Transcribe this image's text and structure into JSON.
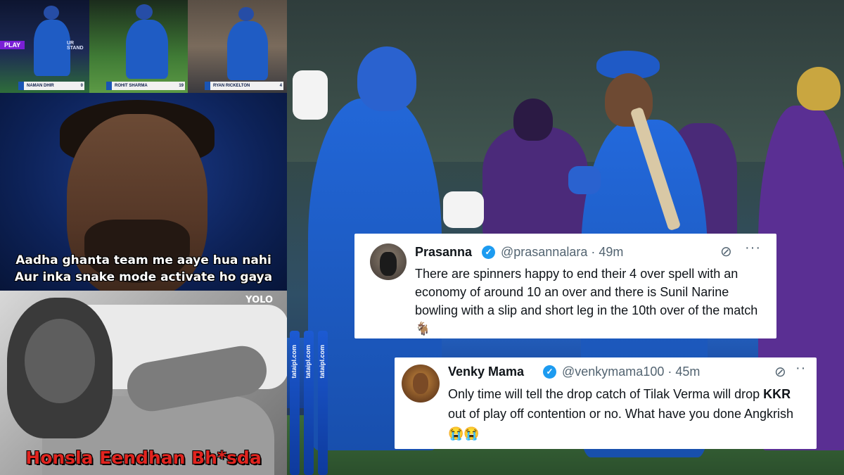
{
  "top_strip": {
    "frame1": {
      "play_tag": "PLAY",
      "stand_tag": "UR STAND",
      "player_name": "NAMAN DHIR",
      "number": "0"
    },
    "frame2": {
      "player_name": "ROHIT SHARMA",
      "number": "19"
    },
    "frame3": {
      "player_name": "RYAN RICKELTON",
      "number": "4"
    }
  },
  "meme_top": {
    "line1": "Aadha ghanta team me aaye hua nahi",
    "line2": "Aur inka snake mode activate ho gaya"
  },
  "meme_bottom": {
    "watermark": "YOLO",
    "caption": "Honsla Eendhan Bh*sda"
  },
  "main_photo": {
    "stump_text": "tataipl.com"
  },
  "tweets": [
    {
      "name": "Prasanna",
      "handle": "@prasannalara",
      "time": "49m",
      "text": "There are spinners happy to end their 4 over spell with an economy of around 10 an over and there is Sunil Narine bowling with a slip and short leg in the 10th over of the match 🐐"
    },
    {
      "name": "Venky Mama",
      "handle": "@venkymama100",
      "time": "45m",
      "text_before": "Only time will tell the drop catch of Tilak Verma will drop ",
      "text_bold": "KKR",
      "text_after": " out of play off contention or no. What have you done Angkrish 😭😭"
    }
  ],
  "icons": {
    "verified": "verified-badge-icon",
    "grok": "grok-icon",
    "more": "more-icon"
  },
  "colors": {
    "mi_blue": "#1f5cc4",
    "kkr_purple": "#4b2a7a",
    "verified_blue": "#1d9bf0",
    "caption_red": "#e0241f"
  }
}
